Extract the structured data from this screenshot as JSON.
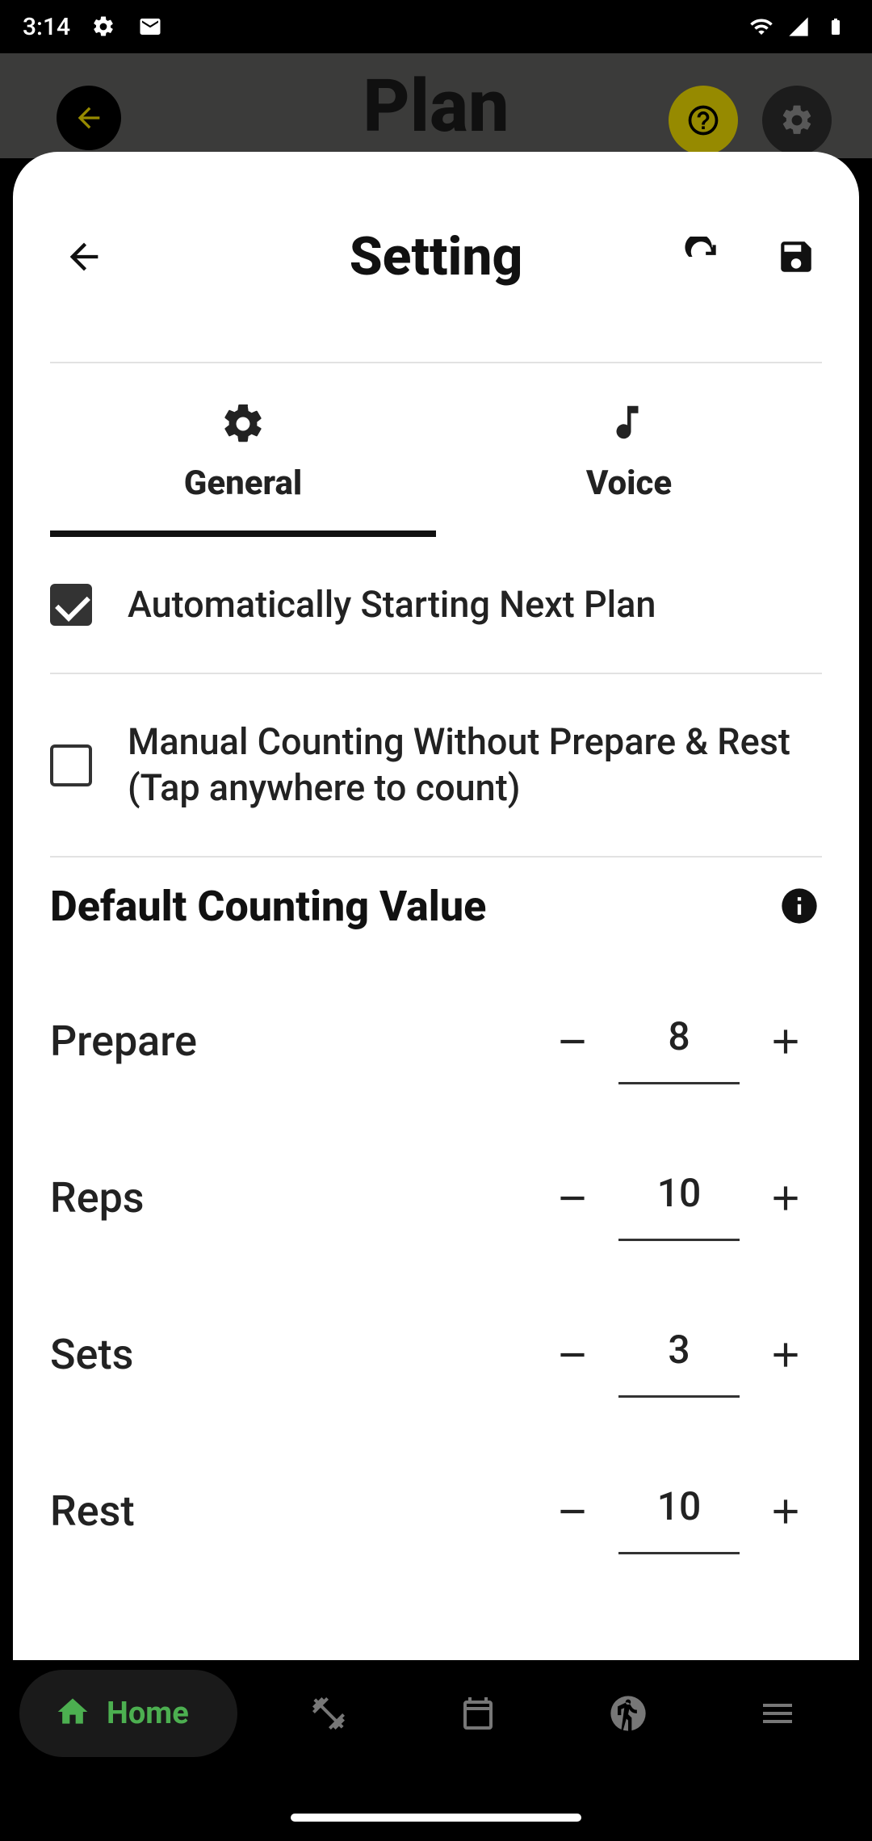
{
  "status": {
    "time": "3:14",
    "icons_left": [
      "gear",
      "messages"
    ],
    "icons_right": [
      "wifi",
      "signal",
      "battery"
    ]
  },
  "backdrop": {
    "title": "Plan"
  },
  "sheet": {
    "title": "Setting",
    "tabs": [
      {
        "label": "General",
        "active": true
      },
      {
        "label": "Voice",
        "active": false
      }
    ],
    "checks": [
      {
        "label": "Automatically Starting Next Plan",
        "checked": true
      },
      {
        "label": "Manual Counting Without Prepare & Rest (Tap anywhere to count)",
        "checked": false
      }
    ],
    "section_title": "Default Counting Value",
    "counters": [
      {
        "label": "Prepare",
        "value": "8"
      },
      {
        "label": "Reps",
        "value": "10"
      },
      {
        "label": "Sets",
        "value": "3"
      },
      {
        "label": "Rest",
        "value": "10"
      }
    ]
  },
  "nav": {
    "home_label": "Home"
  }
}
